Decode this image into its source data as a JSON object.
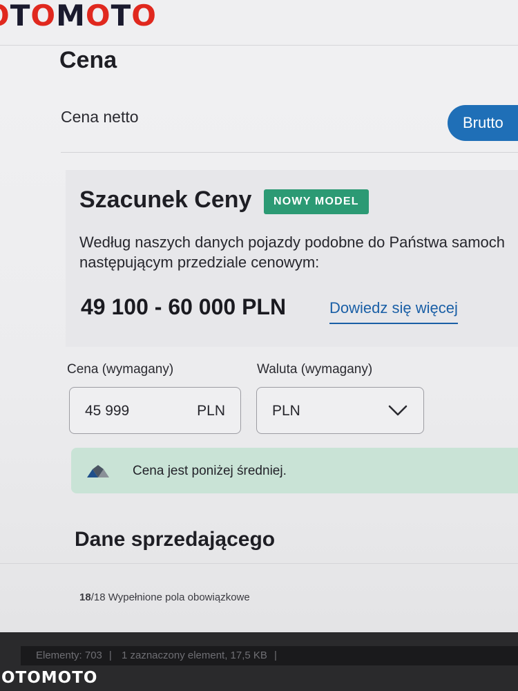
{
  "app": {
    "logo_text": "OTOMOTO"
  },
  "price_section": {
    "title": "Cena",
    "net_label": "Cena netto",
    "toggle_label": "Brutto"
  },
  "estimate": {
    "title": "Szacunek Ceny",
    "badge": "NOWY MODEL",
    "desc_line1": "Według naszych danych pojazdy podobne do Państwa samoch",
    "desc_line2": "następującym przedziale cenowym:",
    "range": "49 100 - 60 000 PLN",
    "link": "Dowiedz się więcej"
  },
  "form": {
    "price_label": "Cena (wymagany)",
    "price_value": "45 999",
    "price_unit": "PLN",
    "currency_label": "Waluta (wymagany)",
    "currency_value": "PLN"
  },
  "notice": {
    "text": "Cena jest poniżej średniej."
  },
  "seller": {
    "title": "Dane sprzedającego"
  },
  "footer": {
    "filled": "18",
    "total": "/18",
    "text": " Wypełnione pola obowiązkowe"
  },
  "statusbar": {
    "elements": "Elementy: 703",
    "selected": "1 zaznaczony element, 17,5 KB"
  },
  "watermark": "OTOMOTO",
  "colors": {
    "brand_red": "#e0281e",
    "toggle_blue": "#1f6fb7",
    "badge_green": "#2c9a74",
    "notice_bg": "#c9e3d6",
    "link_blue": "#1a5fa6"
  }
}
